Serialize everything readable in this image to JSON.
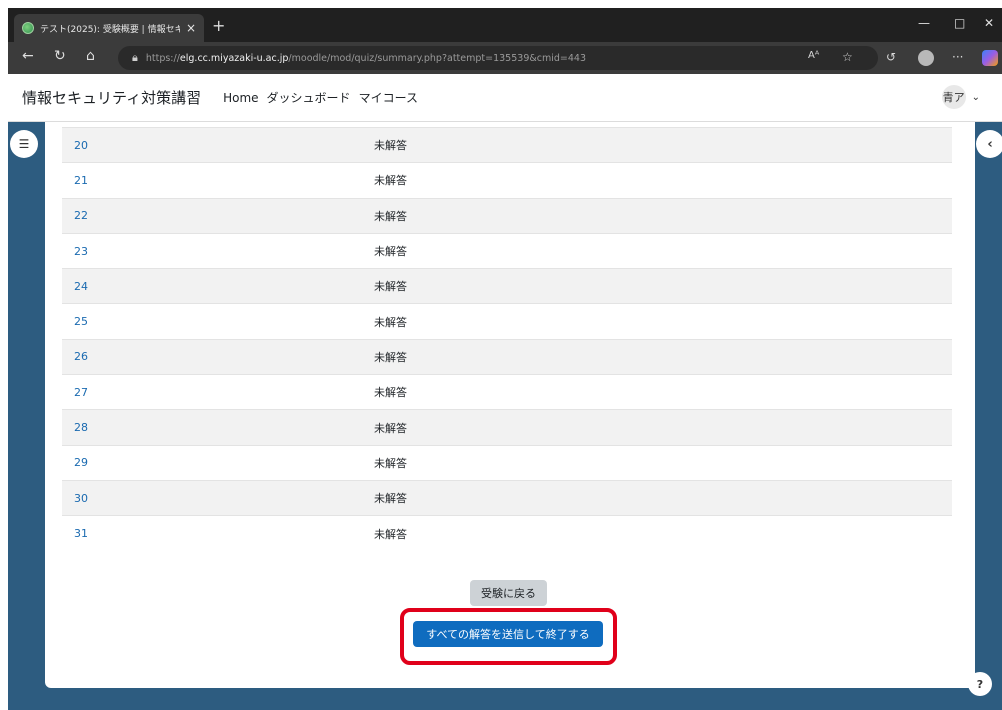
{
  "browser": {
    "tab_title": "テスト(2025): 受験概要 | 情報セキュ",
    "new_tab_symbol": "+",
    "close_symbol": "×",
    "url_prefix": "https://",
    "url_host": "elg.cc.miyazaki-u.ac.jp",
    "url_path": "/moodle/mod/quiz/summary.php?attempt=135539&cmid=443",
    "read_aloud_label": "Aᴬ",
    "more_label": "···"
  },
  "site": {
    "name": "情報セキュリティ対策講習",
    "nav": [
      "Home",
      "ダッシュボード",
      "マイコース"
    ],
    "user_initials": "青ア"
  },
  "summary": {
    "rows": [
      {
        "question": "20",
        "status": "未解答"
      },
      {
        "question": "21",
        "status": "未解答"
      },
      {
        "question": "22",
        "status": "未解答"
      },
      {
        "question": "23",
        "status": "未解答"
      },
      {
        "question": "24",
        "status": "未解答"
      },
      {
        "question": "25",
        "status": "未解答"
      },
      {
        "question": "26",
        "status": "未解答"
      },
      {
        "question": "27",
        "status": "未解答"
      },
      {
        "question": "28",
        "status": "未解答"
      },
      {
        "question": "29",
        "status": "未解答"
      },
      {
        "question": "30",
        "status": "未解答"
      },
      {
        "question": "31",
        "status": "未解答"
      }
    ]
  },
  "actions": {
    "return_label": "受験に戻る",
    "submit_label": "すべての解答を送信して終了する"
  },
  "help_label": "?",
  "colors": {
    "page_background": "#2d5c80",
    "primary_button": "#0f6cbf",
    "secondary_button": "#cdd2d6",
    "highlight": "#e0001a",
    "link": "#1a6ab0"
  }
}
